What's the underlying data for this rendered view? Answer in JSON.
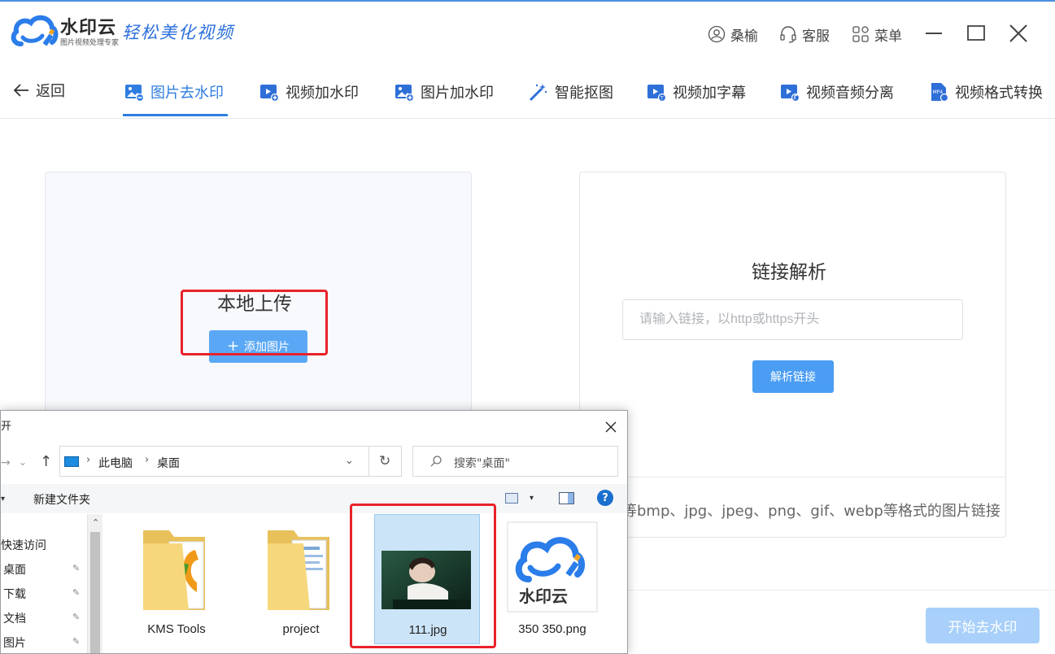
{
  "app": {
    "brand_name": "水印云",
    "brand_sub": "图片视频处理专家",
    "slogan": "轻松美化视频"
  },
  "titlebar": {
    "user": "桑榆",
    "service": "客服",
    "menu": "菜单"
  },
  "nav": {
    "back": "返回",
    "tabs": [
      {
        "label": "图片去水印",
        "icon": "image-remove-icon",
        "active": true
      },
      {
        "label": "视频加水印",
        "icon": "video-add-icon",
        "active": false
      },
      {
        "label": "图片加水印",
        "icon": "image-add-icon",
        "active": false
      },
      {
        "label": "智能抠图",
        "icon": "magic-wand-icon",
        "active": false
      },
      {
        "label": "视频加字幕",
        "icon": "video-subtitle-icon",
        "active": false
      },
      {
        "label": "视频音频分离",
        "icon": "video-audio-icon",
        "active": false
      },
      {
        "label": "视频格式转换",
        "icon": "mp4-icon",
        "active": false
      }
    ]
  },
  "upload": {
    "title": "本地上传",
    "button": "添加图片"
  },
  "link_parse": {
    "title": "链接解析",
    "placeholder": "请输入链接，以http或https开头",
    "button": "解析链接",
    "formats_note": "等bmp、jpg、jpeg、png、gif、webp等格式的图片链接"
  },
  "start_button": "开始去水印",
  "colors": {
    "accent": "#2f7de1",
    "button": "#4a9df3",
    "disabled_button": "#a8d0fa",
    "highlight_box": "#e8222a"
  },
  "dialog": {
    "title": "开",
    "address": [
      "此电脑",
      "桌面"
    ],
    "search_placeholder": "搜索\"桌面\"",
    "new_folder": "新建文件夹",
    "help": "?",
    "tree": [
      {
        "label": "快速访问",
        "pinned": false
      },
      {
        "label": "桌面",
        "pinned": true
      },
      {
        "label": "下载",
        "pinned": true
      },
      {
        "label": "文档",
        "pinned": true
      },
      {
        "label": "图片",
        "pinned": true
      }
    ],
    "files": [
      {
        "name": "KMS Tools",
        "type": "folder",
        "selected": false
      },
      {
        "name": "project",
        "type": "folder",
        "selected": false
      },
      {
        "name": "111.jpg",
        "type": "image",
        "selected": true
      },
      {
        "name": "350 350.png",
        "type": "logo-image",
        "selected": false
      }
    ]
  }
}
